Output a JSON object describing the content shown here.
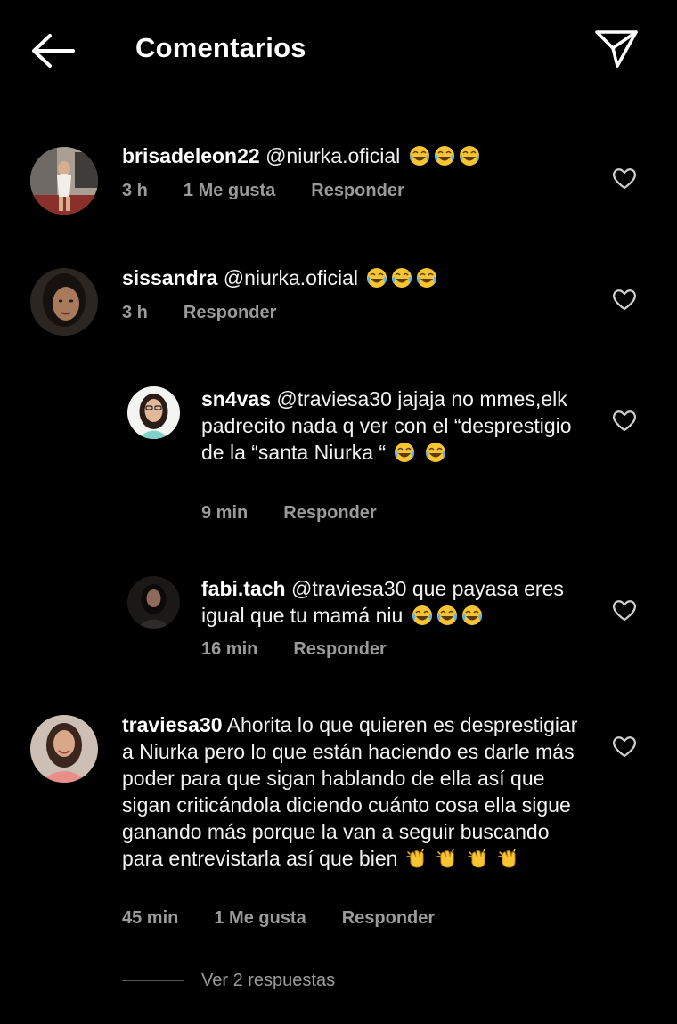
{
  "header": {
    "title": "Comentarios"
  },
  "comments": [
    {
      "username": "brisadeleon22",
      "text": "@niurka.oficial",
      "emojis": [
        "laughing-tears",
        "laughing-tears",
        "laughing-tears"
      ],
      "time": "3 h",
      "likes": "1 Me gusta",
      "reply": "Responder"
    },
    {
      "username": "sissandra",
      "text": "@niurka.oficial",
      "emojis": [
        "laughing-tears",
        "laughing-tears",
        "laughing-tears"
      ],
      "time": "3 h",
      "reply": "Responder"
    },
    {
      "username": "sn4vas",
      "text": "@traviesa30 jajaja no mmes,elk padrecito nada q ver con el “desprestigio de la “santa Niurka “",
      "emojis": [
        "laughing-tears",
        "laughing-tears"
      ],
      "time": "9 min",
      "reply": "Responder"
    },
    {
      "username": "fabi.tach",
      "text": "@traviesa30 que payasa eres igual que tu mamá niu",
      "emojis": [
        "laughing-tears",
        "laughing-tears",
        "laughing-tears"
      ],
      "time": "16 min",
      "reply": "Responder"
    },
    {
      "username": "traviesa30",
      "text": "Ahorita lo que quieren es desprestigiar a Niurka pero lo que están haciendo es darle más poder para que sigan hablando de ella así que sigan criticándola diciendo cuánto cosa ella sigue ganando más porque la van a seguir buscando para entrevistarla así que bien",
      "emojis": [
        "clapping-hands",
        "clapping-hands",
        "clapping-hands",
        "clapping-hands"
      ],
      "time": "45 min",
      "likes": "1 Me gusta",
      "reply": "Responder"
    }
  ],
  "view_replies": "Ver 2 respuestas",
  "colors": {
    "background": "#000000",
    "text": "#ffffff",
    "muted": "#9a9a9a",
    "emoji": "#f7c531"
  }
}
